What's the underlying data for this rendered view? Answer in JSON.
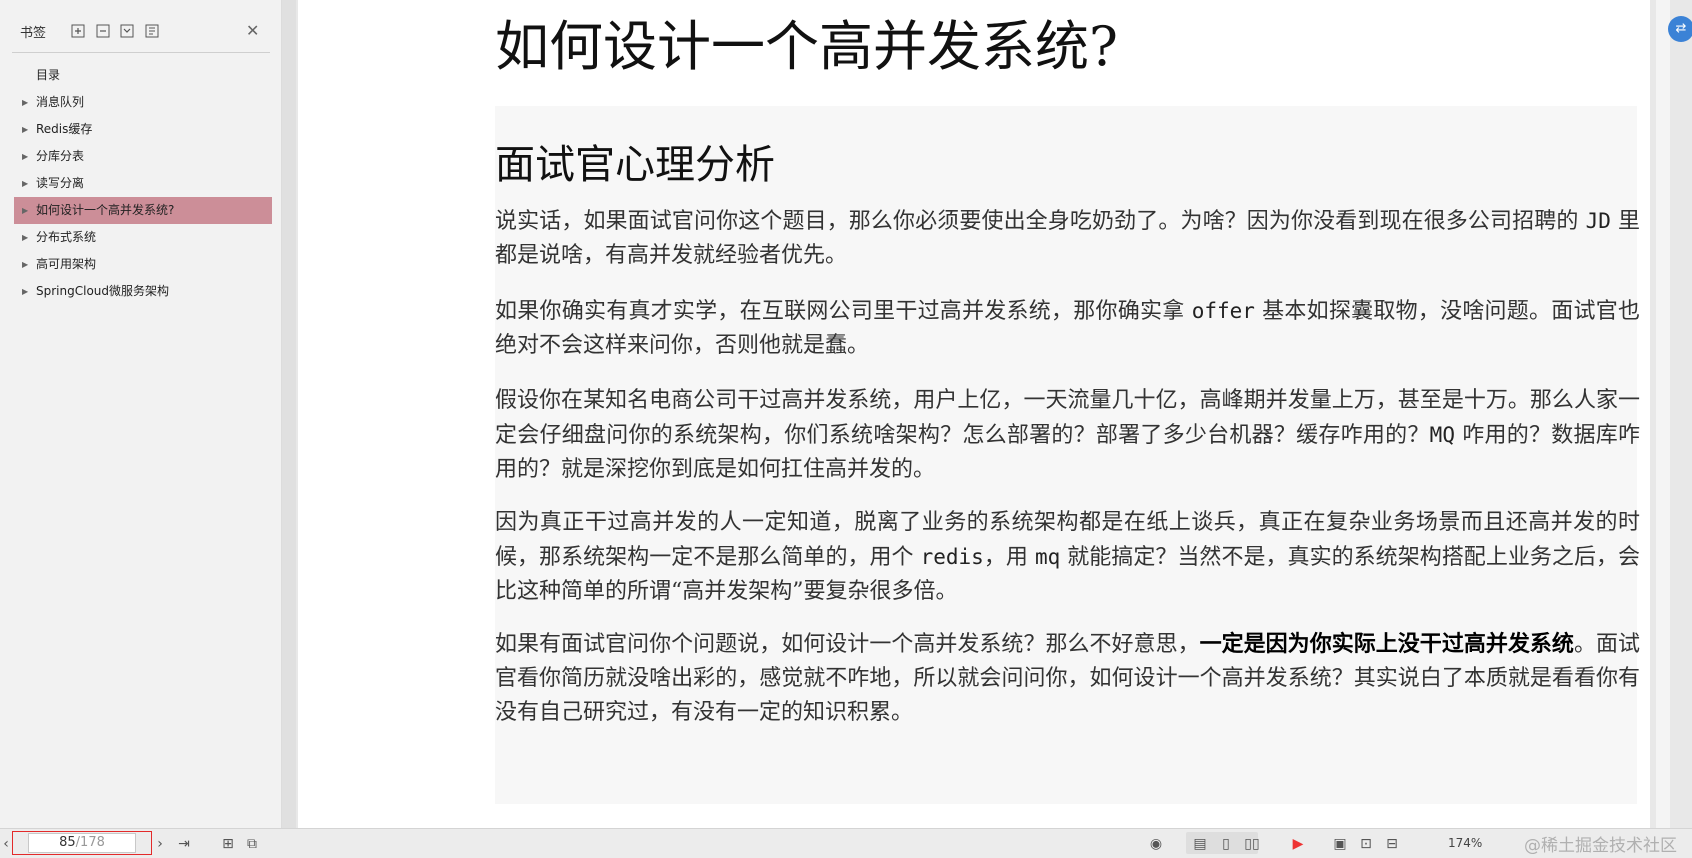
{
  "sidebar": {
    "title": "书签",
    "tools": [
      "add-bookmark-icon",
      "remove-bookmark-icon",
      "expand-bookmark-icon",
      "bookmark-options-icon"
    ],
    "items": [
      {
        "label": "目录",
        "expandable": false,
        "selected": false
      },
      {
        "label": "消息队列",
        "expandable": true,
        "selected": false
      },
      {
        "label": "Redis缓存",
        "expandable": true,
        "selected": false
      },
      {
        "label": "分库分表",
        "expandable": true,
        "selected": false
      },
      {
        "label": "读写分离",
        "expandable": true,
        "selected": false
      },
      {
        "label": "如何设计一个高并发系统?",
        "expandable": true,
        "selected": true
      },
      {
        "label": "分布式系统",
        "expandable": true,
        "selected": false
      },
      {
        "label": "高可用架构",
        "expandable": true,
        "selected": false
      },
      {
        "label": "SpringCloud微服务架构",
        "expandable": true,
        "selected": false
      }
    ]
  },
  "document": {
    "title": "如何设计一个高并发系统?",
    "section_heading": "面试官心理分析",
    "paragraphs": {
      "p1": {
        "a": "说实话，如果面试官问你这个题目，那么你必须要使出全身吃奶劲了。为啥？因为你没看到现在很多公司招聘的 ",
        "code": "JD",
        "b": " 里都是说啥，有高并发就经验者优先。"
      },
      "p2": {
        "a": "如果你确实有真才实学，在互联网公司里干过高并发系统，那你确实拿 ",
        "code": "offer",
        "b": " 基本如探囊取物，没啥问题。面试官也绝对不会这样来问你，否则他就是蠢。"
      },
      "p3": {
        "a": "假设你在某知名电商公司干过高并发系统，用户上亿，一天流量几十亿，高峰期并发量上万，甚至是十万。那么人家一定会仔细盘问你的系统架构，你们系统啥架构？怎么部署的？部署了多少台机器？缓存咋用的？",
        "code": "MQ",
        "b": " 咋用的？数据库咋用的？就是深挖你到底是如何扛住高并发的。"
      },
      "p4": {
        "a": "因为真正干过高并发的人一定知道，脱离了业务的系统架构都是在纸上谈兵，真正在复杂业务场景而且还高并发的时候，那系统架构一定不是那么简单的，用个 ",
        "code1": "redis",
        "mid": "，用 ",
        "code2": "mq",
        "b": " 就能搞定？当然不是，真实的系统架构搭配上业务之后，会比这种简单的所谓“高并发架构”要复杂很多倍。"
      },
      "p5": {
        "a": "如果有面试官问你个问题说，如何设计一个高并发系统？那么不好意思，",
        "bold": "一定是因为你实际上没干过高并发系统",
        "b": "。面试官看你简历就没啥出彩的，感觉就不咋地，所以就会问问你，如何设计一个高并发系统？其实说白了本质就是看看你有没有自己研究过，有没有一定的知识积累。"
      }
    }
  },
  "statusbar": {
    "current_page": "85",
    "total_pages": "/178",
    "zoom": "174%",
    "watermark": "@稀土掘金技术社区"
  },
  "colors": {
    "selected_bookmark": "#cc8e98",
    "page_box_border": "#e32a2a",
    "float_button": "#3b82d6"
  }
}
